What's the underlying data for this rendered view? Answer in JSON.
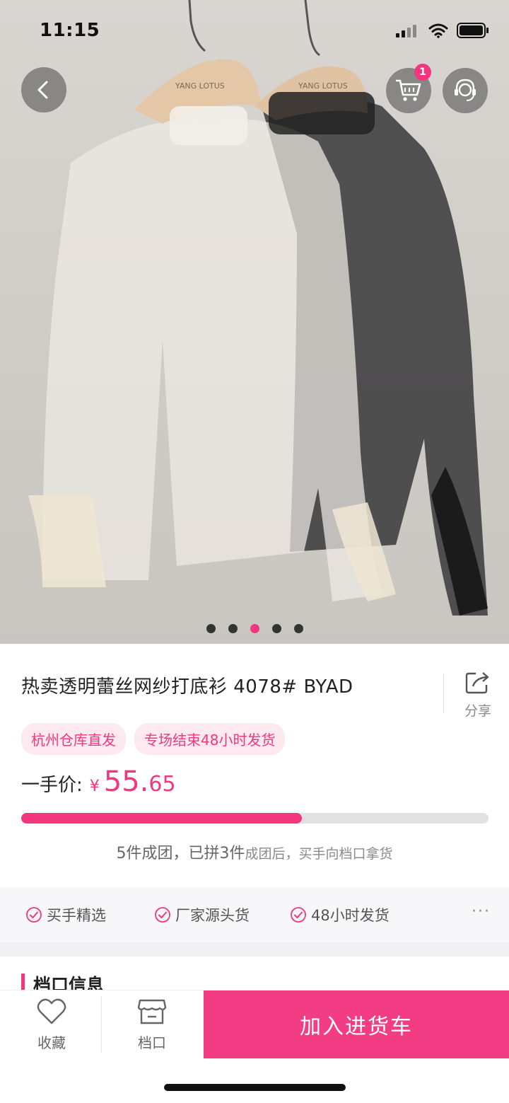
{
  "status_bar": {
    "time": "11:15"
  },
  "header": {
    "cart_badge": "1"
  },
  "carousel": {
    "page_count": 5,
    "active_index": 2,
    "hanger_brand": "YANG LOTUS"
  },
  "product": {
    "title": "热卖透明蕾丝网纱打底衫 4078# BYAD",
    "share_label": "分享",
    "tags": [
      "杭州仓库直发",
      "专场结束48小时发货"
    ],
    "price_label": "一手价:",
    "currency": "¥",
    "price_int": "55.",
    "price_dec": "65",
    "group_progress": 0.6,
    "group_main": "5件成团，已拼3件",
    "group_sub": "成团后，买手向档口拿货"
  },
  "features": {
    "items": [
      "买手精选",
      "厂家源头货",
      "48小时发货"
    ],
    "more": "···"
  },
  "section": {
    "title": "档口信息"
  },
  "bottom_bar": {
    "favorite_label": "收藏",
    "shop_label": "档口",
    "add_to_cart_label": "加入进货车"
  },
  "colors": {
    "accent": "#f2377e",
    "tag_bg": "#fde9ef"
  }
}
